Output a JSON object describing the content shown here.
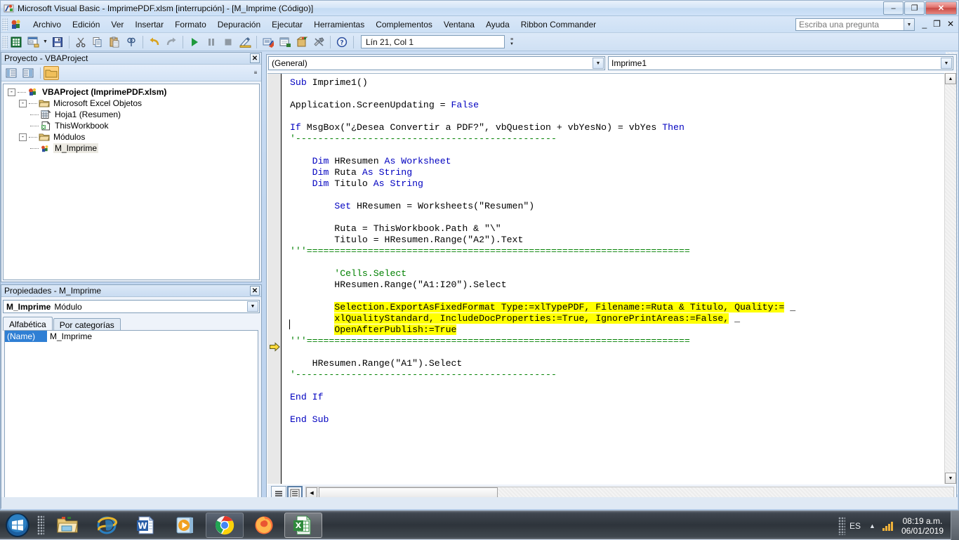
{
  "window": {
    "title": "Microsoft Visual Basic - ImprimePDF.xlsm [interrupción] - [M_Imprime (Código)]",
    "icon": "vb-app-icon",
    "minimize_label": "–",
    "maximize_label": "❐",
    "close_label": "✕"
  },
  "menubar": {
    "items": [
      {
        "label": "Archivo"
      },
      {
        "label": "Edición"
      },
      {
        "label": "Ver"
      },
      {
        "label": "Insertar"
      },
      {
        "label": "Formato"
      },
      {
        "label": "Depuración"
      },
      {
        "label": "Ejecutar"
      },
      {
        "label": "Herramientas"
      },
      {
        "label": "Complementos"
      },
      {
        "label": "Ventana"
      },
      {
        "label": "Ayuda"
      },
      {
        "label": "Ribbon Commander"
      }
    ],
    "question_placeholder": "Escriba una pregunta",
    "mdi_minimize": "_",
    "mdi_restore": "❐",
    "mdi_close": "✕"
  },
  "toolbar": {
    "buttons": [
      {
        "name": "view-excel-icon"
      },
      {
        "name": "insert-userform-icon"
      },
      {
        "name": "save-icon"
      },
      {
        "name": "cut-icon"
      },
      {
        "name": "copy-icon"
      },
      {
        "name": "paste-icon"
      },
      {
        "name": "find-icon"
      },
      {
        "name": "undo-icon"
      },
      {
        "name": "redo-icon"
      },
      {
        "name": "run-icon"
      },
      {
        "name": "pause-icon"
      },
      {
        "name": "stop-icon"
      },
      {
        "name": "design-mode-icon"
      },
      {
        "name": "project-explorer-icon"
      },
      {
        "name": "properties-window-icon"
      },
      {
        "name": "object-browser-icon"
      },
      {
        "name": "toolbox-icon"
      },
      {
        "name": "help-icon"
      }
    ],
    "position_indicator": "Lín 21, Col 1"
  },
  "project_panel": {
    "caption": "Proyecto - VBAProject",
    "close_label": "✕",
    "toolbar_buttons": [
      {
        "name": "view-code-icon"
      },
      {
        "name": "view-object-icon"
      },
      {
        "name": "toggle-folders-icon"
      }
    ],
    "tree": [
      {
        "level": 0,
        "label": "VBAProject (ImprimePDF.xlsm)",
        "icon": "project-icon",
        "expander": "-",
        "bold": true,
        "selected": false
      },
      {
        "level": 1,
        "label": "Microsoft Excel Objetos",
        "icon": "folder-icon",
        "expander": "-",
        "bold": false,
        "selected": false
      },
      {
        "level": 2,
        "label": "Hoja1 (Resumen)",
        "icon": "worksheet-icon",
        "expander": "",
        "bold": false,
        "selected": false
      },
      {
        "level": 2,
        "label": "ThisWorkbook",
        "icon": "workbook-icon",
        "expander": "",
        "bold": false,
        "selected": false
      },
      {
        "level": 1,
        "label": "Módulos",
        "icon": "folder-icon",
        "expander": "-",
        "bold": false,
        "selected": false
      },
      {
        "level": 2,
        "label": "M_Imprime",
        "icon": "module-icon",
        "expander": "",
        "bold": false,
        "selected": true
      }
    ]
  },
  "properties_panel": {
    "caption": "Propiedades - M_Imprime",
    "close_label": "✕",
    "object_name": "M_Imprime",
    "object_type": "Módulo",
    "tabs": [
      {
        "label": "Alfabética",
        "active": true
      },
      {
        "label": "Por categorías",
        "active": false
      }
    ],
    "rows": [
      {
        "name": "(Name)",
        "value": "M_Imprime"
      }
    ]
  },
  "code_window": {
    "object_combo": "(General)",
    "proc_combo": "Imprime1",
    "view_procedure_icon": "procedure-view-icon",
    "view_full_icon": "full-module-view-icon",
    "lines": [
      [
        {
          "t": "Sub ",
          "s": "k"
        },
        {
          "t": "Imprime1()",
          "s": ""
        }
      ],
      [],
      [
        {
          "t": "Application.ScreenUpdating = ",
          "s": ""
        },
        {
          "t": "False",
          "s": "k"
        }
      ],
      [],
      [
        {
          "t": "If ",
          "s": "k"
        },
        {
          "t": "MsgBox(\"¿Desea Convertir a PDF?\", vbQuestion + vbYesNo) = vbYes ",
          "s": ""
        },
        {
          "t": "Then",
          "s": "k"
        }
      ],
      [
        {
          "t": "'-----------------------------------------------",
          "s": "c"
        }
      ],
      [],
      [
        {
          "t": "    ",
          "s": ""
        },
        {
          "t": "Dim ",
          "s": "k"
        },
        {
          "t": "HResumen ",
          "s": ""
        },
        {
          "t": "As ",
          "s": "k"
        },
        {
          "t": "Worksheet",
          "s": "k"
        }
      ],
      [
        {
          "t": "    ",
          "s": ""
        },
        {
          "t": "Dim ",
          "s": "k"
        },
        {
          "t": "Ruta ",
          "s": ""
        },
        {
          "t": "As ",
          "s": "k"
        },
        {
          "t": "String",
          "s": "k"
        }
      ],
      [
        {
          "t": "    ",
          "s": ""
        },
        {
          "t": "Dim ",
          "s": "k"
        },
        {
          "t": "Titulo ",
          "s": ""
        },
        {
          "t": "As ",
          "s": "k"
        },
        {
          "t": "String",
          "s": "k"
        }
      ],
      [],
      [
        {
          "t": "        ",
          "s": ""
        },
        {
          "t": "Set ",
          "s": "k"
        },
        {
          "t": "HResumen = Worksheets(\"Resumen\")",
          "s": ""
        }
      ],
      [],
      [
        {
          "t": "        Ruta = ThisWorkbook.Path & \"\\\"",
          "s": ""
        }
      ],
      [
        {
          "t": "        Titulo = HResumen.Range(\"A2\").Text",
          "s": ""
        }
      ],
      [
        {
          "t": "'''=====================================================================",
          "s": "c"
        }
      ],
      [],
      [
        {
          "t": "        'Cells.Select",
          "s": "c"
        }
      ],
      [
        {
          "t": "        HResumen.Range(\"A1:I20\").Select",
          "s": ""
        }
      ],
      [],
      [
        {
          "t": "        ",
          "s": ""
        },
        {
          "t": "Selection.ExportAsFixedFormat Type:=xlTypePDF, Filename:=Ruta & Titulo, Quality:=",
          "s": "hl"
        },
        {
          "t": " _",
          "s": ""
        }
      ],
      [
        {
          "t": "        ",
          "s": ""
        },
        {
          "t": "xlQualityStandard, IncludeDocProperties:=True, IgnorePrintAreas:=False,",
          "s": "hl"
        },
        {
          "t": " _",
          "s": ""
        }
      ],
      [
        {
          "t": "        ",
          "s": ""
        },
        {
          "t": "OpenAfterPublish:=True",
          "s": "hl"
        }
      ],
      [
        {
          "t": "'''=====================================================================",
          "s": "c"
        }
      ],
      [],
      [
        {
          "t": "    HResumen.Range(\"A1\").Select",
          "s": ""
        }
      ],
      [
        {
          "t": "'-----------------------------------------------",
          "s": "c"
        }
      ],
      [],
      [
        {
          "t": "End If",
          "s": "k"
        }
      ],
      [],
      [
        {
          "t": "End Sub",
          "s": "k"
        }
      ]
    ]
  },
  "taskbar": {
    "start_label": "start-orb",
    "items": [
      {
        "name": "explorer-icon",
        "state": "pinned"
      },
      {
        "name": "internet-explorer-icon",
        "state": "pinned"
      },
      {
        "name": "word-icon",
        "state": "pinned"
      },
      {
        "name": "media-player-icon",
        "state": "pinned"
      },
      {
        "name": "chrome-icon",
        "state": "running"
      },
      {
        "name": "firefox-icon",
        "state": "pinned"
      },
      {
        "name": "excel-icon",
        "state": "active"
      }
    ],
    "tray": {
      "language": "ES",
      "show_hidden": "▲",
      "network_icon": "network-signal-icon",
      "time": "08:19 a.m.",
      "date": "06/01/2019"
    }
  }
}
